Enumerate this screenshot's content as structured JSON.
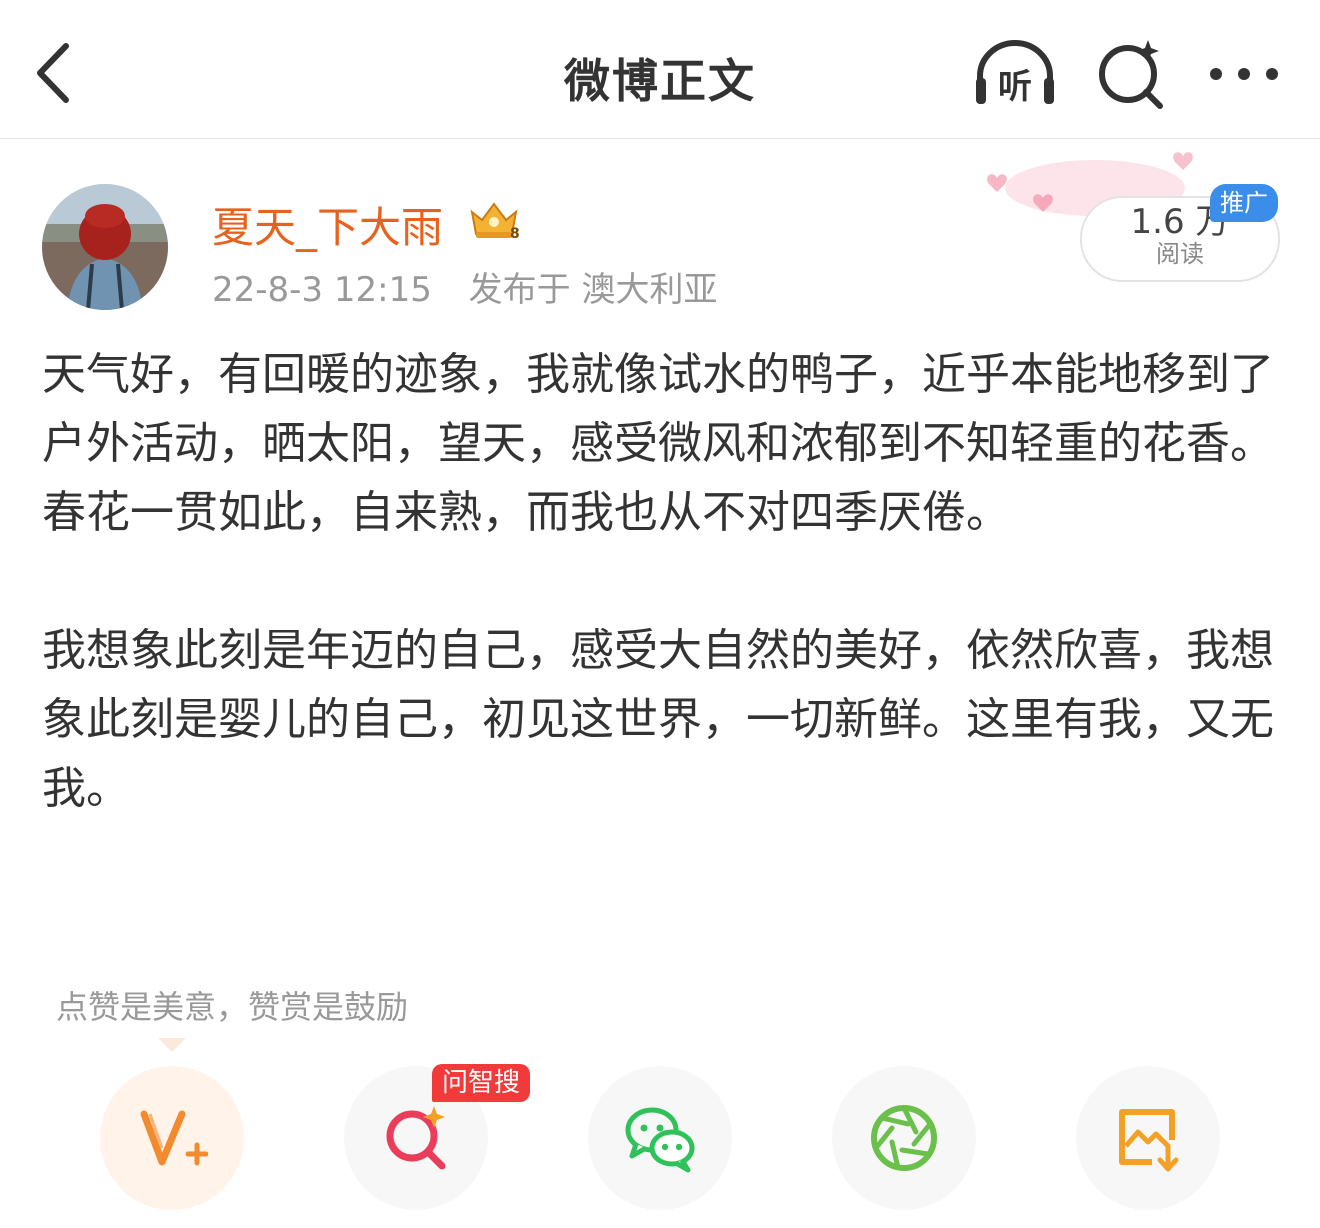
{
  "nav": {
    "title": "微博正文",
    "listen_label": "听"
  },
  "author": {
    "name": "夏天_下大雨",
    "time": "22-8-3 12:15",
    "location": "发布于 澳大利亚"
  },
  "stats": {
    "reads_count": "1.6 万",
    "reads_label": "阅读",
    "promo_badge": "推广"
  },
  "post": {
    "paragraph1": "天气好，有回暖的迹象，我就像试水的鸭子，近乎本能地移到了户外活动，晒太阳，望天，感受微风和浓郁到不知轻重的花香。春花一贯如此，自来熟，而我也从不对四季厌倦。",
    "paragraph2": "我想象此刻是年迈的自己，感受大自然的美好，依然欣喜，我想象此刻是婴儿的自己，初见这世界，一切新鲜。这里有我，又无我。"
  },
  "actions": {
    "hint": "点赞是美意，赞赏是鼓励",
    "search_badge": "问智搜"
  },
  "colors": {
    "author_orange": "#e8621f",
    "promo_blue": "#3a8de8",
    "badge_red": "#f23a3a",
    "wechat_green": "#2fc25a",
    "moments_green": "#6bc04b"
  }
}
